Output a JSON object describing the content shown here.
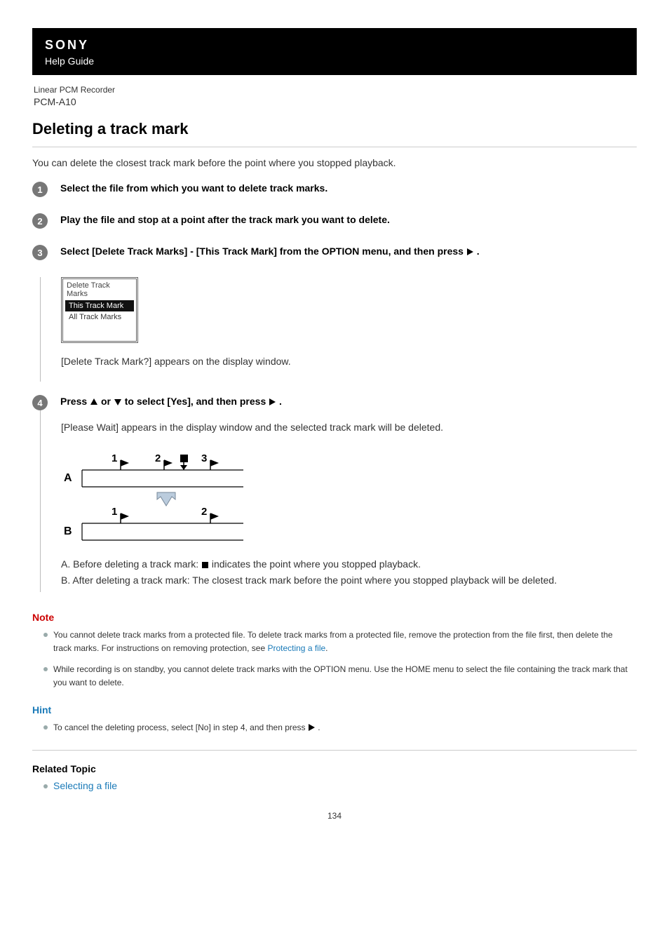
{
  "header": {
    "brand": "SONY",
    "help_guide": "Help Guide",
    "product_line": "Linear PCM Recorder",
    "model": "PCM-A10"
  },
  "topic": {
    "title": "Deleting a track mark",
    "intro": "You can delete the closest track mark before the point where you stopped playback."
  },
  "steps": {
    "s1": {
      "num": "1",
      "head": "Select the file from which you want to delete track marks."
    },
    "s2": {
      "num": "2",
      "head": "Play the file and stop at a point after the track mark you want to delete."
    },
    "s3": {
      "num": "3",
      "head_pre": "Select [Delete Track Marks] - [This Track Mark] from the OPTION menu, and then press",
      "head_post": ".",
      "menu_title": "Delete Track Marks",
      "menu_sel": "This Track Mark",
      "menu_item": "All Track Marks",
      "sub": "[Delete Track Mark?] appears on the display window."
    },
    "s4": {
      "num": "4",
      "head_pre": "Press",
      "head_mid": "or",
      "head_mid2": "to select [Yes], and then press",
      "head_post": ".",
      "sub1": "[Please Wait] appears in the display window and the selected track mark will be deleted.",
      "a_pre": "A. Before deleting a track mark: ",
      "a_post": "indicates the point where you stopped playback.",
      "b": "B. After deleting a track mark: The closest track mark before the point where you stopped playback will be deleted."
    }
  },
  "note": {
    "title": "Note",
    "n1a": "You cannot delete track marks from a protected file. To delete track marks from a protected file, remove the protection from the file first, then delete the track marks. For instructions on removing protection, see ",
    "n1_link": "Protecting a file",
    "n1b": ".",
    "n2": "While recording is on standby, you cannot delete track marks with the OPTION menu. Use the HOME menu to select the file containing the track mark that you want to delete."
  },
  "hint": {
    "title": "Hint",
    "h1a": "To cancel the deleting process, select [No] in step 4, and then press",
    "h1b": "."
  },
  "related": {
    "title": "Related Topic",
    "r1": "Selecting a file"
  },
  "page_num": "134"
}
